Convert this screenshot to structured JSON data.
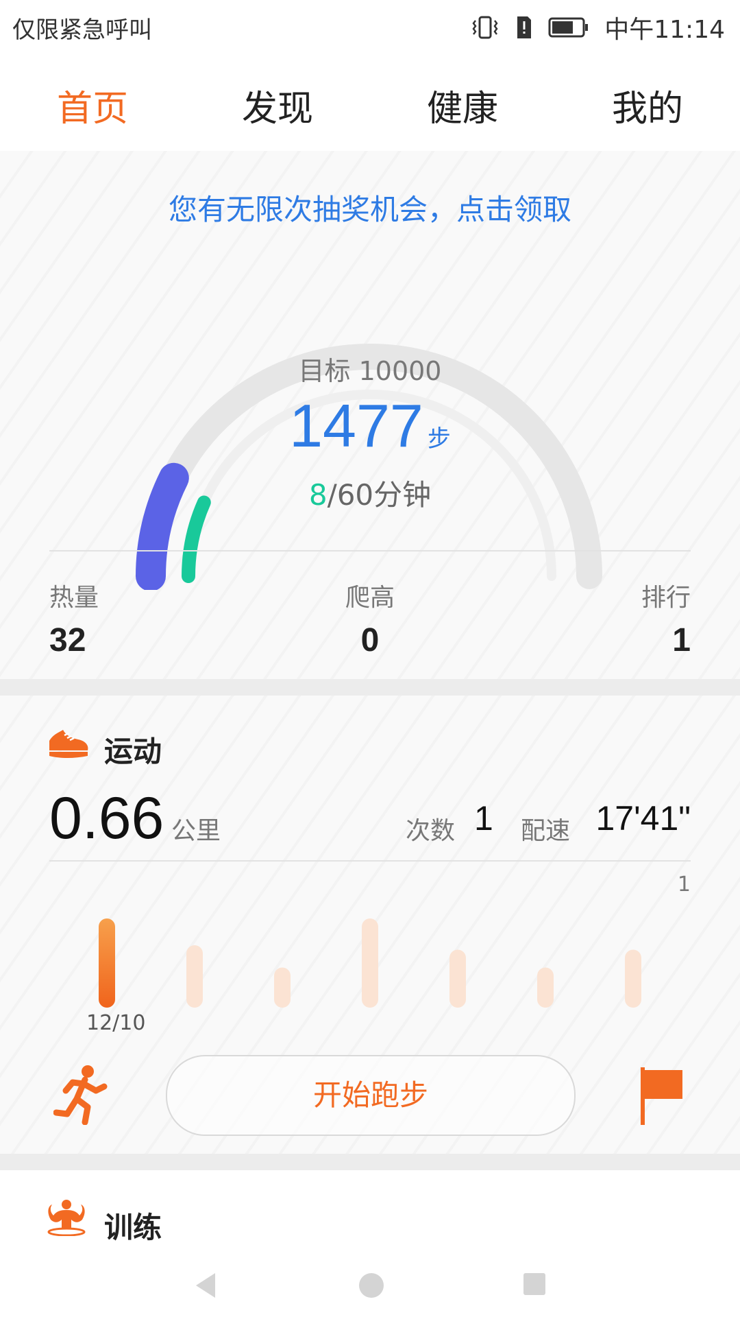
{
  "status_bar": {
    "carrier_text": "仅限紧急呼叫",
    "time": "中午11:14",
    "icons": [
      "vibrate-icon",
      "alert-icon",
      "battery-icon"
    ]
  },
  "tabs": [
    {
      "label": "首页",
      "active": true
    },
    {
      "label": "发现",
      "active": false
    },
    {
      "label": "健康",
      "active": false
    },
    {
      "label": "我的",
      "active": false
    }
  ],
  "promo": {
    "text": "您有无限次抽奖机会，点击领取"
  },
  "steps": {
    "goal_label": "目标 10000",
    "count": "1477",
    "unit": "步",
    "active_minutes": "8",
    "minutes_rest": "/60分钟",
    "step_progress": 0.1477,
    "minute_progress": 0.133
  },
  "stats": [
    {
      "label": "热量",
      "value": "32"
    },
    {
      "label": "爬高",
      "value": "0"
    },
    {
      "label": "排行",
      "value": "1"
    }
  ],
  "sport": {
    "title": "运动",
    "distance": "0.66",
    "distance_unit": "公里",
    "count_label": "次数",
    "count_value": "1",
    "pace_label": "配速",
    "pace_value": "17'41\"",
    "chart_max": "1",
    "date_label": "12/10",
    "start_button": "开始跑步"
  },
  "training": {
    "title": "训练"
  },
  "colors": {
    "accent": "#f26a22",
    "blue": "#2e7be4",
    "green": "#19c99a",
    "purple": "#5b63e6"
  },
  "chart_data": {
    "type": "bar",
    "categories": [
      "12/10",
      "",
      "",
      "",
      "",
      "",
      ""
    ],
    "values": [
      1,
      0,
      0,
      0,
      0,
      0,
      0
    ],
    "ylim": [
      0,
      1
    ]
  }
}
